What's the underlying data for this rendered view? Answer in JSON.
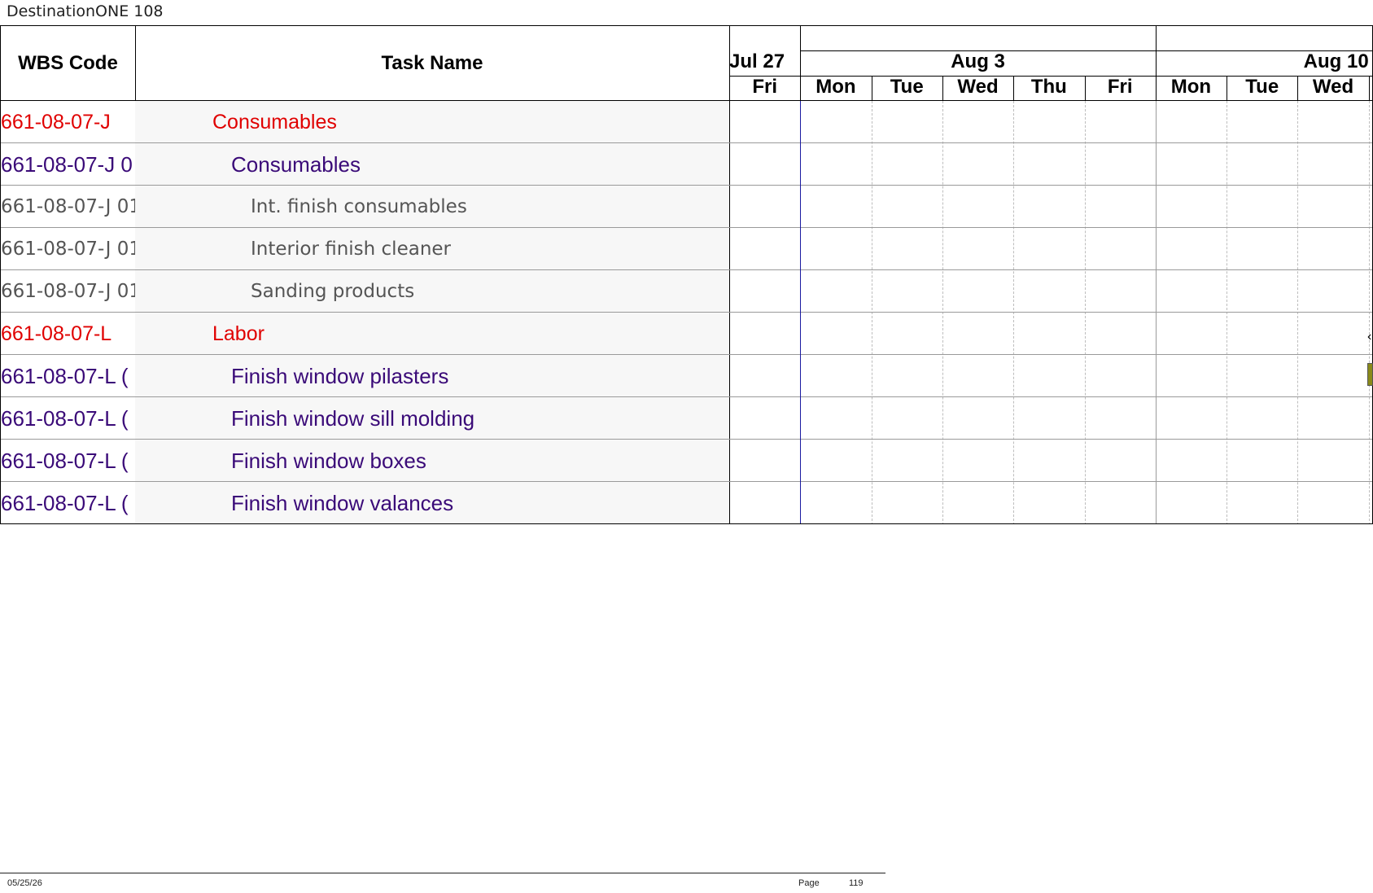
{
  "document": {
    "title": "DestinationONE 108"
  },
  "columns": {
    "wbs_header": "WBS Code",
    "name_header": "Task Name"
  },
  "timeline": {
    "months": [
      "Jul 27",
      "Aug 3",
      "Aug 10"
    ],
    "days": [
      "Fri",
      "Mon",
      "Tue",
      "Wed",
      "Thu",
      "Fri",
      "Mon",
      "Tue",
      "Wed"
    ]
  },
  "rows": [
    {
      "wbs": "661-08-07-J",
      "name": "Consumables",
      "level": 1
    },
    {
      "wbs": "661-08-07-J 0",
      "name": "Consumables",
      "level": 2
    },
    {
      "wbs": "661-08-07-J 01",
      "name": "Int. finish consumables",
      "level": 3
    },
    {
      "wbs": "661-08-07-J 01",
      "name": "Interior finish cleaner",
      "level": 3
    },
    {
      "wbs": "661-08-07-J 01",
      "name": "Sanding products",
      "level": 3
    },
    {
      "wbs": "661-08-07-L",
      "name": "Labor",
      "level": 1
    },
    {
      "wbs": "661-08-07-L (",
      "name": "Finish window pilasters",
      "level": 2
    },
    {
      "wbs": "661-08-07-L (",
      "name": "Finish window sill molding",
      "level": 2
    },
    {
      "wbs": "661-08-07-L (",
      "name": "Finish window boxes",
      "level": 2
    },
    {
      "wbs": "661-08-07-L (",
      "name": "Finish window valances",
      "level": 2
    }
  ],
  "footer": {
    "date": "05/25/26",
    "page_label": "Page",
    "page_number": "119"
  },
  "colors": {
    "level1": "#e00000",
    "level2": "#3a0a78",
    "level3": "#555555",
    "today_line": "#1a1aa0",
    "bar": "#8a8a1a"
  }
}
